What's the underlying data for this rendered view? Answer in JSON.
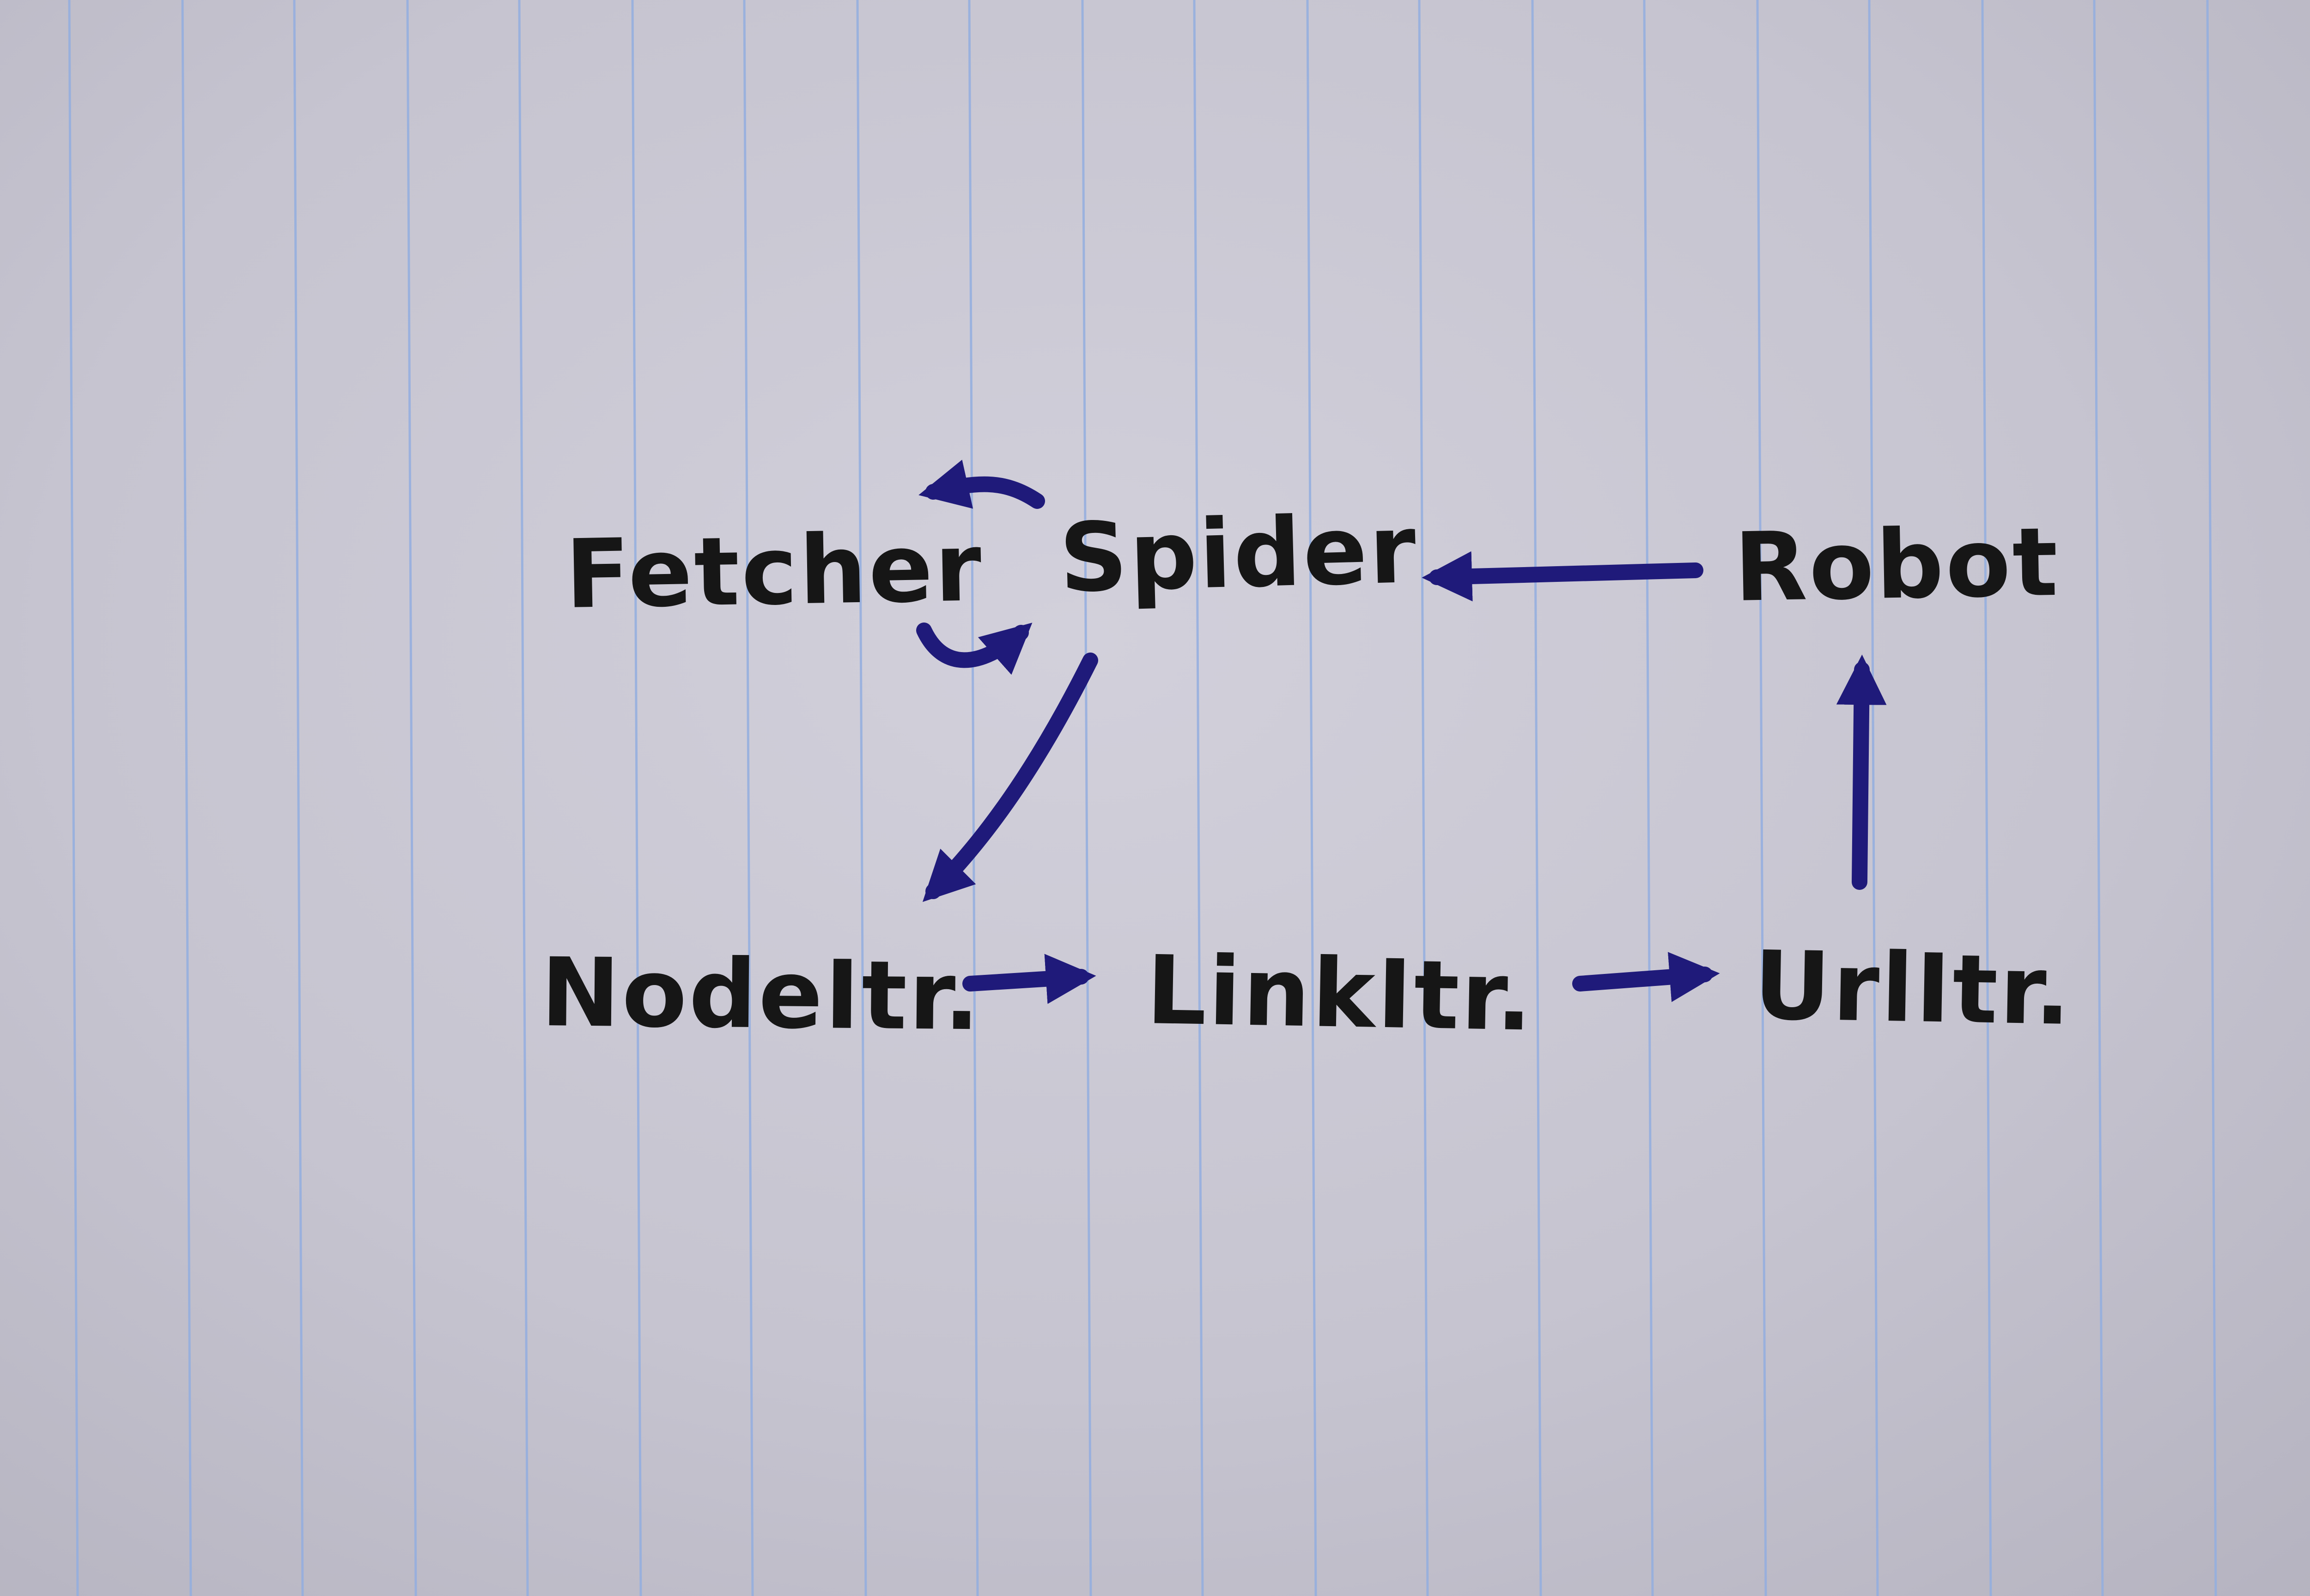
{
  "diagram": {
    "ink_colors": {
      "text": "#161616",
      "arrow": "#1f1a7a",
      "ruling": "#93aee0"
    },
    "nodes": [
      {
        "id": "fetcher",
        "label": "Fetcher"
      },
      {
        "id": "spider",
        "label": "Spider"
      },
      {
        "id": "robot",
        "label": "Robot"
      },
      {
        "id": "nodeitr",
        "label": "NodeItr."
      },
      {
        "id": "linkitr",
        "label": "LinkItr."
      },
      {
        "id": "urlitr",
        "label": "UrlItr."
      }
    ],
    "edges": [
      {
        "from": "spider",
        "to": "fetcher"
      },
      {
        "from": "fetcher",
        "to": "spider"
      },
      {
        "from": "robot",
        "to": "spider"
      },
      {
        "from": "spider",
        "to": "nodeitr"
      },
      {
        "from": "nodeitr",
        "to": "linkitr"
      },
      {
        "from": "linkitr",
        "to": "urlitr"
      },
      {
        "from": "urlitr",
        "to": "robot"
      }
    ]
  }
}
